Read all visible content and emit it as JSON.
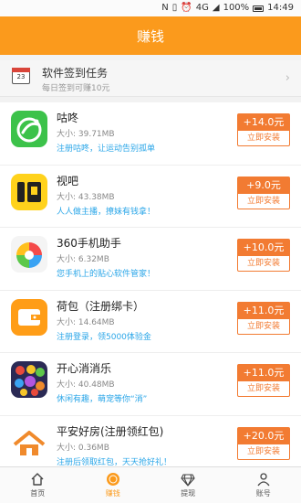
{
  "status": {
    "battery": "100%",
    "time": "14:49",
    "network": "4G"
  },
  "header": {
    "title": "赚钱"
  },
  "task": {
    "title": "软件签到任务",
    "subtitle": "每日签到可赚10元",
    "calendar_day": "23"
  },
  "apps": [
    {
      "name": "咕咚",
      "size": "大小: 39.71MB",
      "desc": "注册咕咚，让运动告别孤单",
      "reward": "+14.0元",
      "action": "立即安装"
    },
    {
      "name": "视吧",
      "size": "大小: 43.38MB",
      "desc": "人人做主播，撩妹有钱拿！",
      "reward": "+9.0元",
      "action": "立即安装"
    },
    {
      "name": "360手机助手",
      "size": "大小: 6.32MB",
      "desc": "您手机上的贴心软件管家！",
      "reward": "+10.0元",
      "action": "立即安装"
    },
    {
      "name": "荷包（注册绑卡）",
      "size": "大小: 14.64MB",
      "desc": "注册登录，领5000体验金",
      "reward": "+11.0元",
      "action": "立即安装"
    },
    {
      "name": "开心消消乐",
      "size": "大小: 40.48MB",
      "desc": "休闲有趣，萌宠等你“消”",
      "reward": "+11.0元",
      "action": "立即安装"
    },
    {
      "name": "平安好房(注册领红包)",
      "size": "大小: 0.36MB",
      "desc": "注册后领取红包，天天抢好礼！",
      "reward": "+20.0元",
      "action": "立即安装"
    }
  ],
  "nav": [
    {
      "label": "首页",
      "icon": "home-icon"
    },
    {
      "label": "赚钱",
      "icon": "coin-icon"
    },
    {
      "label": "提现",
      "icon": "diamond-icon"
    },
    {
      "label": "账号",
      "icon": "user-icon"
    }
  ],
  "colors": {
    "primary": "#fb9a1c",
    "reward": "#f27b32",
    "desc": "#2aa6e8"
  }
}
